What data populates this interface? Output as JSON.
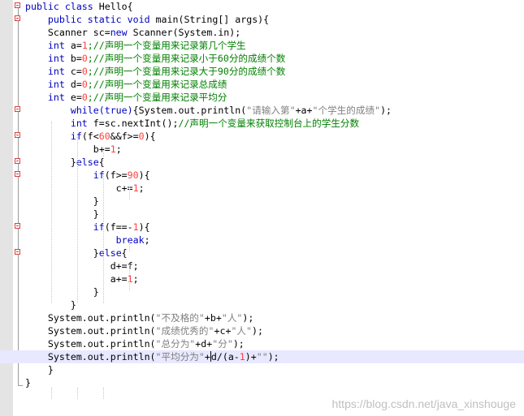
{
  "editor": {
    "lines": [
      [
        {
          "t": "public class ",
          "c": "kw"
        },
        {
          "t": "Hello{",
          "c": "pl"
        }
      ],
      [
        {
          "t": "    public static void ",
          "c": "kw"
        },
        {
          "t": "main(String[] args){",
          "c": "pl"
        }
      ],
      [
        {
          "t": "    Scanner sc=",
          "c": "pl"
        },
        {
          "t": "new ",
          "c": "kw"
        },
        {
          "t": "Scanner(System.in);",
          "c": "pl"
        }
      ],
      [
        {
          "t": "    int ",
          "c": "kw"
        },
        {
          "t": "a=",
          "c": "pl"
        },
        {
          "t": "1",
          "c": "num"
        },
        {
          "t": ";//声明一个变量用来记录第几个学生",
          "c": "cm"
        }
      ],
      [
        {
          "t": "    int ",
          "c": "kw"
        },
        {
          "t": "b=",
          "c": "pl"
        },
        {
          "t": "0",
          "c": "num"
        },
        {
          "t": ";//声明一个变量用来记录小于60分的成绩个数",
          "c": "cm"
        }
      ],
      [
        {
          "t": "    int ",
          "c": "kw"
        },
        {
          "t": "c=",
          "c": "pl"
        },
        {
          "t": "0",
          "c": "num"
        },
        {
          "t": ";//声明一个变量用来记录大于90分的成绩个数",
          "c": "cm"
        }
      ],
      [
        {
          "t": "    int ",
          "c": "kw"
        },
        {
          "t": "d=",
          "c": "pl"
        },
        {
          "t": "0",
          "c": "num"
        },
        {
          "t": ";//声明一个变量用来记录总成绩",
          "c": "cm"
        }
      ],
      [
        {
          "t": "    int ",
          "c": "kw"
        },
        {
          "t": "e=",
          "c": "pl"
        },
        {
          "t": "0",
          "c": "num"
        },
        {
          "t": ";//声明一个变量用来记录平均分",
          "c": "cm"
        }
      ],
      [
        {
          "t": "        while(true)",
          "c": "kw"
        },
        {
          "t": "{System.out.println(",
          "c": "pl"
        },
        {
          "t": "\"请输入第\"",
          "c": "str"
        },
        {
          "t": "+a+",
          "c": "pl"
        },
        {
          "t": "\"个学生的成绩\"",
          "c": "str"
        },
        {
          "t": ");",
          "c": "pl"
        }
      ],
      [
        {
          "t": "        int ",
          "c": "kw"
        },
        {
          "t": "f=sc.nextInt();",
          "c": "pl"
        },
        {
          "t": "//声明一个变量来获取控制台上的学生分数",
          "c": "cm"
        }
      ],
      [
        {
          "t": "        if",
          "c": "kw"
        },
        {
          "t": "(f<",
          "c": "pl"
        },
        {
          "t": "60",
          "c": "num"
        },
        {
          "t": "&&f>=",
          "c": "pl"
        },
        {
          "t": "0",
          "c": "num"
        },
        {
          "t": "){",
          "c": "pl"
        }
      ],
      [
        {
          "t": "            b+=",
          "c": "pl"
        },
        {
          "t": "1",
          "c": "num"
        },
        {
          "t": ";",
          "c": "pl"
        }
      ],
      [
        {
          "t": "        }",
          "c": "pl"
        },
        {
          "t": "else",
          "c": "kw"
        },
        {
          "t": "{",
          "c": "pl"
        }
      ],
      [
        {
          "t": "            if",
          "c": "kw"
        },
        {
          "t": "(f>=",
          "c": "pl"
        },
        {
          "t": "90",
          "c": "num"
        },
        {
          "t": "){",
          "c": "pl"
        }
      ],
      [
        {
          "t": "                c+=",
          "c": "pl"
        },
        {
          "t": "1",
          "c": "num"
        },
        {
          "t": ";",
          "c": "pl"
        }
      ],
      [
        {
          "t": "            }",
          "c": "pl"
        }
      ],
      [
        {
          "t": "            }",
          "c": "pl"
        }
      ],
      [
        {
          "t": "            if",
          "c": "kw"
        },
        {
          "t": "(f==-",
          "c": "pl"
        },
        {
          "t": "1",
          "c": "num"
        },
        {
          "t": "){",
          "c": "pl"
        }
      ],
      [
        {
          "t": "                break",
          "c": "kw"
        },
        {
          "t": ";",
          "c": "pl"
        }
      ],
      [
        {
          "t": "            }",
          "c": "pl"
        },
        {
          "t": "else",
          "c": "kw"
        },
        {
          "t": "{",
          "c": "pl"
        }
      ],
      [
        {
          "t": "               d+=f;",
          "c": "pl"
        }
      ],
      [
        {
          "t": "               a+=",
          "c": "pl"
        },
        {
          "t": "1",
          "c": "num"
        },
        {
          "t": ";",
          "c": "pl"
        }
      ],
      [
        {
          "t": "            }",
          "c": "pl"
        }
      ],
      [
        {
          "t": "        }",
          "c": "pl"
        }
      ],
      [
        {
          "t": "    System.out.println(",
          "c": "pl"
        },
        {
          "t": "\"不及格的\"",
          "c": "str"
        },
        {
          "t": "+b+",
          "c": "pl"
        },
        {
          "t": "\"人\"",
          "c": "str"
        },
        {
          "t": ");",
          "c": "pl"
        }
      ],
      [
        {
          "t": "    System.out.println(",
          "c": "pl"
        },
        {
          "t": "\"成绩优秀的\"",
          "c": "str"
        },
        {
          "t": "+c+",
          "c": "pl"
        },
        {
          "t": "\"人\"",
          "c": "str"
        },
        {
          "t": ");",
          "c": "pl"
        }
      ],
      [
        {
          "t": "    System.out.println(",
          "c": "pl"
        },
        {
          "t": "\"总分为\"",
          "c": "str"
        },
        {
          "t": "+d+",
          "c": "pl"
        },
        {
          "t": "\"分\"",
          "c": "str"
        },
        {
          "t": ");",
          "c": "pl"
        }
      ],
      [
        {
          "t": "    System.out.println(",
          "c": "pl"
        },
        {
          "t": "\"平均分为\"",
          "c": "str"
        },
        {
          "t": "+",
          "c": "pl"
        },
        {
          "t": "|",
          "c": "caret"
        },
        {
          "t": "d/(a-",
          "c": "pl"
        },
        {
          "t": "1",
          "c": "num"
        },
        {
          "t": ")+",
          "c": "pl"
        },
        {
          "t": "\"\"",
          "c": "str"
        },
        {
          "t": ");",
          "c": "pl"
        }
      ],
      [
        {
          "t": "    }",
          "c": "pl"
        }
      ],
      [
        {
          "t": "}",
          "c": "pl"
        }
      ]
    ],
    "current_line": 27,
    "markers": [
      0,
      1,
      8,
      10,
      12,
      13,
      17,
      19
    ]
  },
  "watermark": "https://blog.csdn.net/java_xinshouge"
}
